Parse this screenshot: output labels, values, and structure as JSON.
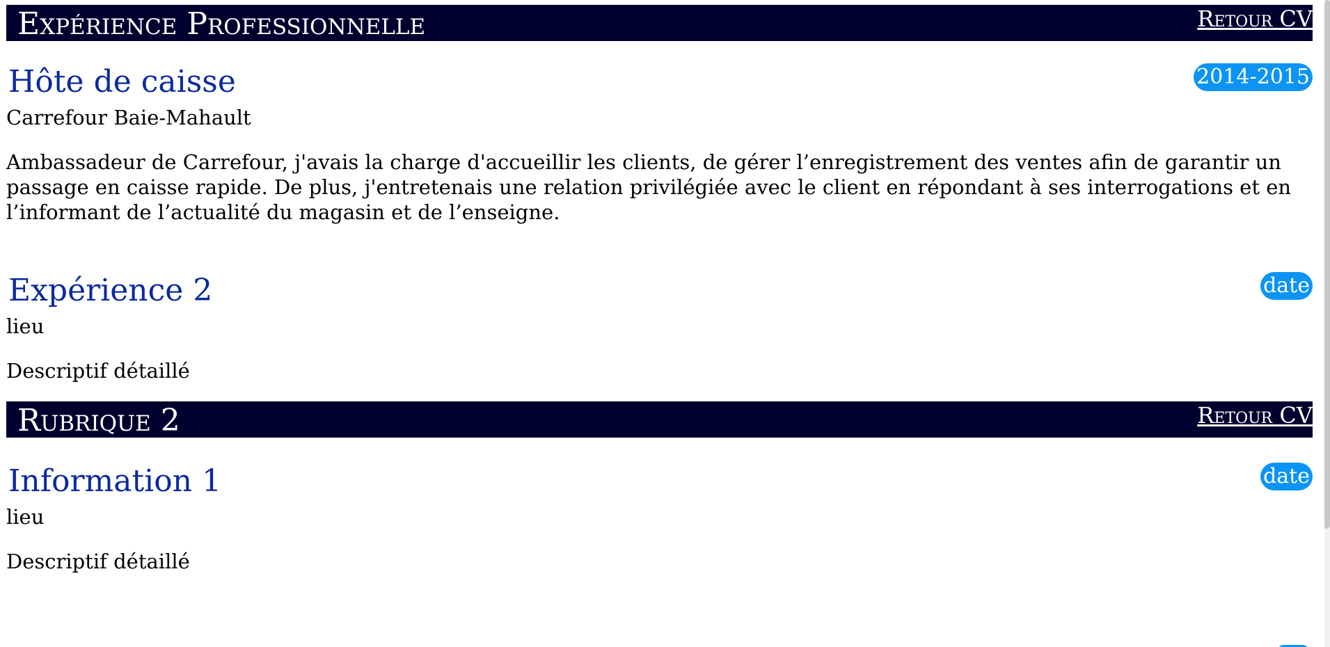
{
  "sections": [
    {
      "title": "Expérience Professionnelle",
      "back_link": "Retour CV",
      "entries": [
        {
          "title": "Hôte de caisse",
          "date": "2014-2015",
          "place": "Carrefour Baie-Mahault",
          "description": "Ambassadeur de Carrefour, j'avais la charge d'accueillir les clients, de gérer l’enregistrement des ventes afin de garantir un passage en caisse rapide. De plus, j'entretenais une relation privilégiée avec le client en répondant à ses interrogations et en l’informant de l’actualité du magasin et de l’enseigne."
        },
        {
          "title": "Expérience 2",
          "date": "date",
          "place": "lieu",
          "description": "Descriptif détaillé"
        }
      ]
    },
    {
      "title": "Rubrique 2",
      "back_link": "Retour CV",
      "entries": [
        {
          "title": "Information 1",
          "date": "date",
          "place": "lieu",
          "description": "Descriptif détaillé"
        }
      ]
    }
  ],
  "colors": {
    "header_bg": "#00002e",
    "title_blue": "#0a2a9e",
    "badge_blue": "#0c94f4"
  }
}
